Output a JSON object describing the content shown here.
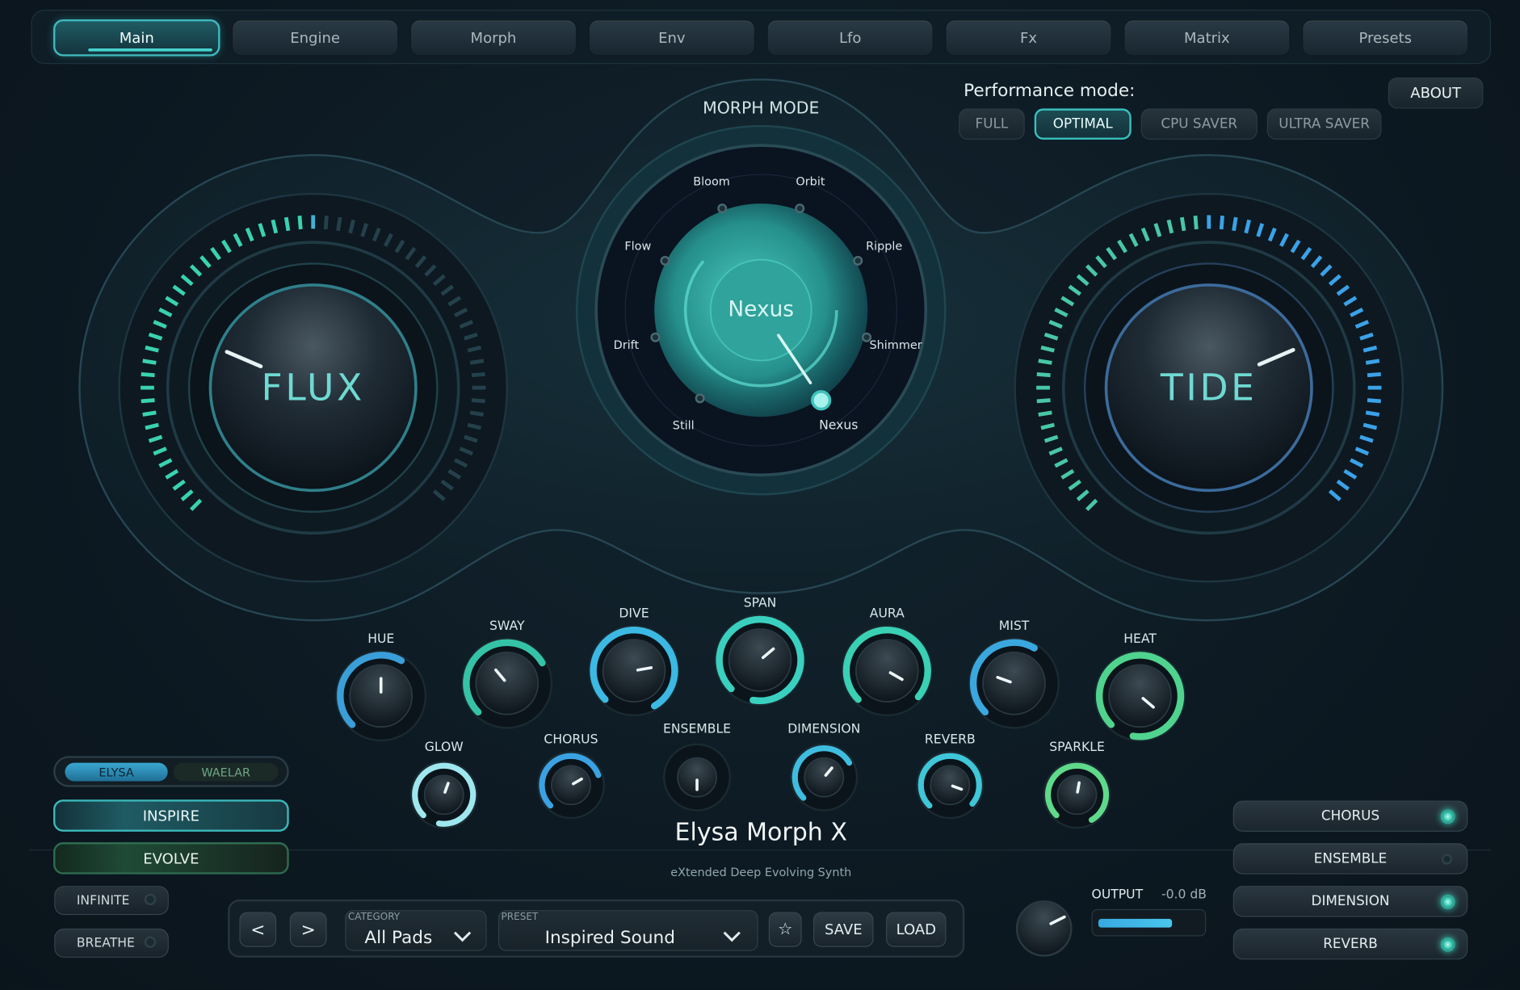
{
  "tabs": [
    {
      "label": "Main",
      "active": true
    },
    {
      "label": "Engine"
    },
    {
      "label": "Morph"
    },
    {
      "label": "Env"
    },
    {
      "label": "Lfo"
    },
    {
      "label": "Fx"
    },
    {
      "label": "Matrix"
    },
    {
      "label": "Presets"
    }
  ],
  "about_label": "ABOUT",
  "performance": {
    "label": "Performance mode:",
    "options": [
      "FULL",
      "OPTIMAL",
      "CPU SAVER",
      "ULTRA SAVER"
    ],
    "selected": "OPTIMAL"
  },
  "morph": {
    "title": "MORPH MODE",
    "current": "Nexus",
    "modes": [
      "Bloom",
      "Orbit",
      "Ripple",
      "Shimmer",
      "Nexus",
      "Still",
      "Drift",
      "Flow"
    ]
  },
  "macros": {
    "flux": {
      "label": "FLUX"
    },
    "tide": {
      "label": "TIDE"
    }
  },
  "knobs_row1": [
    {
      "label": "HUE"
    },
    {
      "label": "SWAY"
    },
    {
      "label": "DIVE"
    },
    {
      "label": "SPAN"
    },
    {
      "label": "AURA"
    },
    {
      "label": "MIST"
    },
    {
      "label": "HEAT"
    }
  ],
  "knobs_row2": [
    {
      "label": "GLOW"
    },
    {
      "label": "CHORUS"
    },
    {
      "label": "ENSEMBLE"
    },
    {
      "label": "DIMENSION"
    },
    {
      "label": "REVERB"
    },
    {
      "label": "SPARKLE"
    }
  ],
  "engine_toggle": {
    "options": [
      "ELYSA",
      "WAELAR"
    ],
    "selected": "ELYSA"
  },
  "inspire_label": "INSPIRE",
  "evolve_label": "EVOLVE",
  "infinite_label": "INFINITE",
  "breathe_label": "BREATHE",
  "product": {
    "name": "Elysa Morph X",
    "tagline": "eXtended Deep Evolving Synth"
  },
  "browser": {
    "prev": "<",
    "next": ">",
    "category_label": "CATEGORY",
    "category_value": "All Pads",
    "preset_label": "PRESET",
    "preset_value": "Inspired Sound",
    "star": "☆",
    "save": "SAVE",
    "load": "LOAD"
  },
  "output": {
    "label": "OUTPUT",
    "value": "-0.0 dB"
  },
  "fx_buttons": [
    {
      "label": "CHORUS",
      "on": true
    },
    {
      "label": "ENSEMBLE",
      "on": false
    },
    {
      "label": "DIMENSION",
      "on": true
    },
    {
      "label": "REVERB",
      "on": true
    }
  ],
  "colors": {
    "accent": "#3fc9c4",
    "blue": "#39a9e6",
    "green": "#4bd68e",
    "bg": "#0b1620"
  }
}
